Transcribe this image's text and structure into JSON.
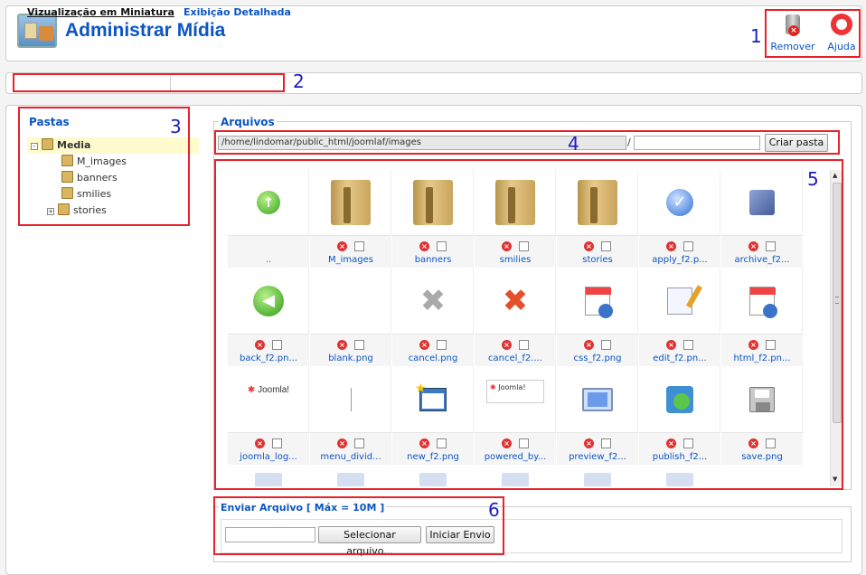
{
  "header": {
    "title": "Administrar Mídia",
    "remove_label": "Remover",
    "help_label": "Ajuda"
  },
  "tabs": {
    "thumbnail": "Vizualização em Miniatura",
    "detail": "Exibição Detalhada"
  },
  "folders": {
    "title": "Pastas",
    "root": "Media",
    "children": [
      "M_images",
      "banners",
      "smilies",
      "stories"
    ]
  },
  "files": {
    "legend": "Arquivos",
    "path_value": "/home/lindomar/public_html/joomlaf/images",
    "separator": "/",
    "newfolder_value": "",
    "create_button": "Criar pasta",
    "items": [
      {
        "name": "..",
        "kind": "up"
      },
      {
        "name": "M_images",
        "kind": "folder"
      },
      {
        "name": "banners",
        "kind": "folder"
      },
      {
        "name": "smilies",
        "kind": "folder"
      },
      {
        "name": "stories",
        "kind": "folder"
      },
      {
        "name": "apply_f2.p...",
        "kind": "apply"
      },
      {
        "name": "archive_f2...",
        "kind": "archive"
      },
      {
        "name": "back_f2.pn...",
        "kind": "back"
      },
      {
        "name": "blank.png",
        "kind": "blank"
      },
      {
        "name": "cancel.png",
        "kind": "cancelgray"
      },
      {
        "name": "cancel_f2....",
        "kind": "cancel"
      },
      {
        "name": "css_f2.png",
        "kind": "css"
      },
      {
        "name": "edit_f2.pn...",
        "kind": "edit"
      },
      {
        "name": "html_f2.pn...",
        "kind": "html"
      },
      {
        "name": "joomla_log...",
        "kind": "joomla"
      },
      {
        "name": "menu_divid...",
        "kind": "divider"
      },
      {
        "name": "new_f2.png",
        "kind": "new"
      },
      {
        "name": "powered_by...",
        "kind": "powered"
      },
      {
        "name": "preview_f2...",
        "kind": "preview"
      },
      {
        "name": "publish_f2...",
        "kind": "publish"
      },
      {
        "name": "save.png",
        "kind": "save"
      }
    ]
  },
  "upload": {
    "legend": "Enviar Arquivo [ Máx = 10M ]",
    "select_button": "Selecionar arquivo...",
    "start_button": "Iniciar Envio"
  },
  "annotations": [
    "1",
    "2",
    "3",
    "4",
    "5",
    "6"
  ],
  "colors": {
    "accent": "#0b55c4",
    "annotation_box": "#e8202a",
    "annotation_number": "#1d1dbf",
    "tree_highlight": "#fffbcc"
  }
}
